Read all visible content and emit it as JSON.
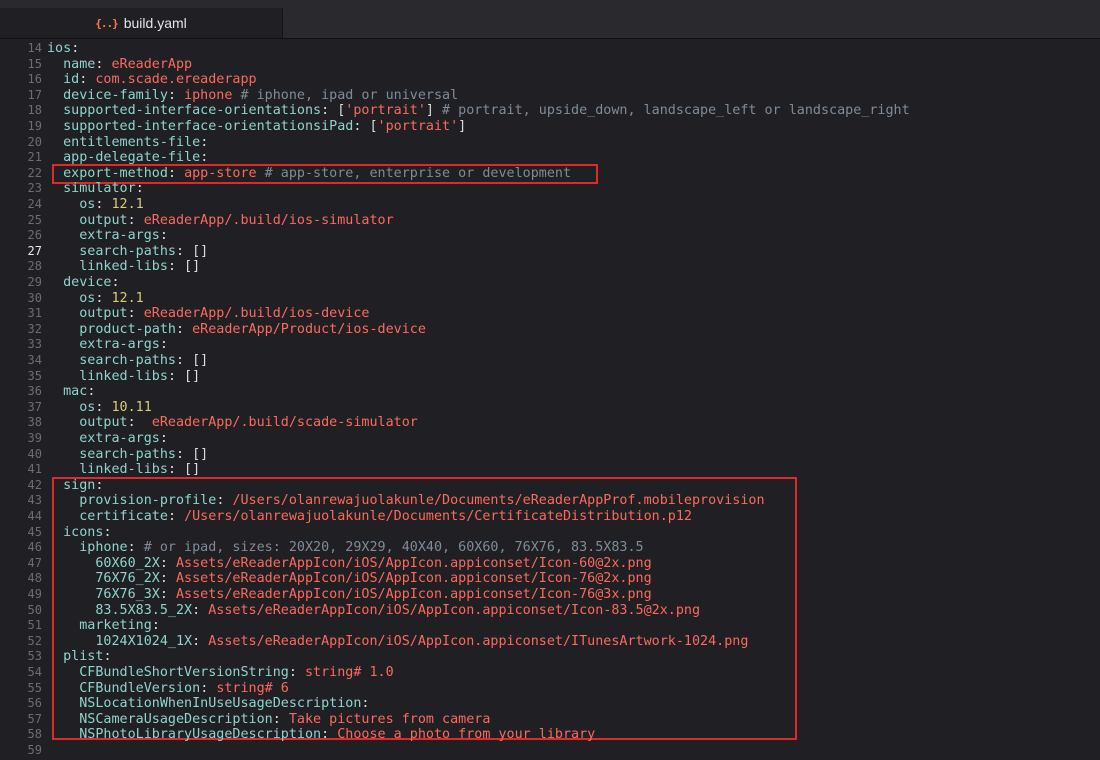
{
  "tab": {
    "icon_text": "{..}",
    "title": "build.yaml"
  },
  "lines": [
    {
      "no": "14",
      "parts": [
        {
          "t": "k",
          "v": "ios"
        },
        {
          "t": "p",
          "v": ":"
        }
      ]
    },
    {
      "no": "15",
      "parts": [
        {
          "t": "p",
          "v": "  "
        },
        {
          "t": "k",
          "v": "name"
        },
        {
          "t": "p",
          "v": ": "
        },
        {
          "t": "s",
          "v": "eReaderApp"
        }
      ]
    },
    {
      "no": "16",
      "parts": [
        {
          "t": "p",
          "v": "  "
        },
        {
          "t": "k",
          "v": "id"
        },
        {
          "t": "p",
          "v": ": "
        },
        {
          "t": "s",
          "v": "com.scade.ereaderapp"
        }
      ]
    },
    {
      "no": "17",
      "parts": [
        {
          "t": "p",
          "v": "  "
        },
        {
          "t": "k",
          "v": "device-family"
        },
        {
          "t": "p",
          "v": ": "
        },
        {
          "t": "s",
          "v": "iphone"
        },
        {
          "t": "c",
          "v": " # iphone, ipad or universal"
        }
      ]
    },
    {
      "no": "18",
      "parts": [
        {
          "t": "p",
          "v": "  "
        },
        {
          "t": "k",
          "v": "supported-interface-orientations"
        },
        {
          "t": "p",
          "v": ": ["
        },
        {
          "t": "s",
          "v": "'portrait'"
        },
        {
          "t": "p",
          "v": "]"
        },
        {
          "t": "c",
          "v": " # portrait, upside_down, landscape_left or landscape_right"
        }
      ]
    },
    {
      "no": "19",
      "parts": [
        {
          "t": "p",
          "v": "  "
        },
        {
          "t": "k",
          "v": "supported-interface-orientationsiPad"
        },
        {
          "t": "p",
          "v": ": ["
        },
        {
          "t": "s",
          "v": "'portrait'"
        },
        {
          "t": "p",
          "v": "]"
        }
      ]
    },
    {
      "no": "20",
      "parts": [
        {
          "t": "p",
          "v": "  "
        },
        {
          "t": "k",
          "v": "entitlements-file"
        },
        {
          "t": "p",
          "v": ":"
        }
      ]
    },
    {
      "no": "21",
      "parts": [
        {
          "t": "p",
          "v": "  "
        },
        {
          "t": "k",
          "v": "app-delegate-file"
        },
        {
          "t": "p",
          "v": ":"
        }
      ]
    },
    {
      "no": "22",
      "parts": [
        {
          "t": "p",
          "v": "  "
        },
        {
          "t": "k",
          "v": "export-method"
        },
        {
          "t": "p",
          "v": ": "
        },
        {
          "t": "s",
          "v": "app-store"
        },
        {
          "t": "c",
          "v": " # app-store, enterprise or development"
        }
      ]
    },
    {
      "no": "23",
      "parts": [
        {
          "t": "p",
          "v": "  "
        },
        {
          "t": "k",
          "v": "simulator"
        },
        {
          "t": "p",
          "v": ":"
        }
      ]
    },
    {
      "no": "24",
      "parts": [
        {
          "t": "p",
          "v": "    "
        },
        {
          "t": "k",
          "v": "os"
        },
        {
          "t": "p",
          "v": ": "
        },
        {
          "t": "n",
          "v": "12.1"
        }
      ]
    },
    {
      "no": "25",
      "parts": [
        {
          "t": "p",
          "v": "    "
        },
        {
          "t": "k",
          "v": "output"
        },
        {
          "t": "p",
          "v": ": "
        },
        {
          "t": "s",
          "v": "eReaderApp/.build/ios-simulator"
        }
      ]
    },
    {
      "no": "26",
      "parts": [
        {
          "t": "p",
          "v": "    "
        },
        {
          "t": "k",
          "v": "extra-args"
        },
        {
          "t": "p",
          "v": ":"
        }
      ]
    },
    {
      "no": "27",
      "current": true,
      "parts": [
        {
          "t": "p",
          "v": "    "
        },
        {
          "t": "k",
          "v": "search-paths"
        },
        {
          "t": "p",
          "v": ": []"
        }
      ]
    },
    {
      "no": "28",
      "parts": [
        {
          "t": "p",
          "v": "    "
        },
        {
          "t": "k",
          "v": "linked-libs"
        },
        {
          "t": "p",
          "v": ": []"
        }
      ]
    },
    {
      "no": "29",
      "parts": [
        {
          "t": "p",
          "v": "  "
        },
        {
          "t": "k",
          "v": "device"
        },
        {
          "t": "p",
          "v": ":"
        }
      ]
    },
    {
      "no": "30",
      "parts": [
        {
          "t": "p",
          "v": "    "
        },
        {
          "t": "k",
          "v": "os"
        },
        {
          "t": "p",
          "v": ": "
        },
        {
          "t": "n",
          "v": "12.1"
        }
      ]
    },
    {
      "no": "31",
      "parts": [
        {
          "t": "p",
          "v": "    "
        },
        {
          "t": "k",
          "v": "output"
        },
        {
          "t": "p",
          "v": ": "
        },
        {
          "t": "s",
          "v": "eReaderApp/.build/ios-device"
        }
      ]
    },
    {
      "no": "32",
      "parts": [
        {
          "t": "p",
          "v": "    "
        },
        {
          "t": "k",
          "v": "product-path"
        },
        {
          "t": "p",
          "v": ": "
        },
        {
          "t": "s",
          "v": "eReaderApp/Product/ios-device"
        }
      ]
    },
    {
      "no": "33",
      "parts": [
        {
          "t": "p",
          "v": "    "
        },
        {
          "t": "k",
          "v": "extra-args"
        },
        {
          "t": "p",
          "v": ":"
        }
      ]
    },
    {
      "no": "34",
      "parts": [
        {
          "t": "p",
          "v": "    "
        },
        {
          "t": "k",
          "v": "search-paths"
        },
        {
          "t": "p",
          "v": ": []"
        }
      ]
    },
    {
      "no": "35",
      "parts": [
        {
          "t": "p",
          "v": "    "
        },
        {
          "t": "k",
          "v": "linked-libs"
        },
        {
          "t": "p",
          "v": ": []"
        }
      ]
    },
    {
      "no": "36",
      "parts": [
        {
          "t": "p",
          "v": "  "
        },
        {
          "t": "k",
          "v": "mac"
        },
        {
          "t": "p",
          "v": ":"
        }
      ]
    },
    {
      "no": "37",
      "parts": [
        {
          "t": "p",
          "v": "    "
        },
        {
          "t": "k",
          "v": "os"
        },
        {
          "t": "p",
          "v": ": "
        },
        {
          "t": "n",
          "v": "10.11"
        }
      ]
    },
    {
      "no": "38",
      "parts": [
        {
          "t": "p",
          "v": "    "
        },
        {
          "t": "k",
          "v": "output"
        },
        {
          "t": "p",
          "v": ":  "
        },
        {
          "t": "s",
          "v": "eReaderApp/.build/scade-simulator"
        }
      ]
    },
    {
      "no": "39",
      "parts": [
        {
          "t": "p",
          "v": "    "
        },
        {
          "t": "k",
          "v": "extra-args"
        },
        {
          "t": "p",
          "v": ":"
        }
      ]
    },
    {
      "no": "40",
      "parts": [
        {
          "t": "p",
          "v": "    "
        },
        {
          "t": "k",
          "v": "search-paths"
        },
        {
          "t": "p",
          "v": ": []"
        }
      ]
    },
    {
      "no": "41",
      "parts": [
        {
          "t": "p",
          "v": "    "
        },
        {
          "t": "k",
          "v": "linked-libs"
        },
        {
          "t": "p",
          "v": ": []"
        }
      ]
    },
    {
      "no": "42",
      "parts": [
        {
          "t": "p",
          "v": "  "
        },
        {
          "t": "k",
          "v": "sign"
        },
        {
          "t": "p",
          "v": ":"
        }
      ]
    },
    {
      "no": "43",
      "parts": [
        {
          "t": "p",
          "v": "    "
        },
        {
          "t": "k",
          "v": "provision-profile"
        },
        {
          "t": "p",
          "v": ": "
        },
        {
          "t": "s",
          "v": "/Users/olanrewajuolakunle/Documents/eReaderAppProf.mobileprovision"
        }
      ]
    },
    {
      "no": "44",
      "parts": [
        {
          "t": "p",
          "v": "    "
        },
        {
          "t": "k",
          "v": "certificate"
        },
        {
          "t": "p",
          "v": ": "
        },
        {
          "t": "s",
          "v": "/Users/olanrewajuolakunle/Documents/CertificateDistribution.p12"
        }
      ]
    },
    {
      "no": "45",
      "parts": [
        {
          "t": "p",
          "v": "  "
        },
        {
          "t": "k",
          "v": "icons"
        },
        {
          "t": "p",
          "v": ":"
        }
      ]
    },
    {
      "no": "46",
      "parts": [
        {
          "t": "p",
          "v": "    "
        },
        {
          "t": "k",
          "v": "iphone"
        },
        {
          "t": "p",
          "v": ":"
        },
        {
          "t": "c",
          "v": " # or ipad, sizes: 20X20, 29X29, 40X40, 60X60, 76X76, 83.5X83.5"
        }
      ]
    },
    {
      "no": "47",
      "parts": [
        {
          "t": "p",
          "v": "      "
        },
        {
          "t": "k",
          "v": "60X60_2X"
        },
        {
          "t": "p",
          "v": ": "
        },
        {
          "t": "s",
          "v": "Assets/eReaderAppIcon/iOS/AppIcon.appiconset/Icon-60@2x.png"
        }
      ]
    },
    {
      "no": "48",
      "parts": [
        {
          "t": "p",
          "v": "      "
        },
        {
          "t": "k",
          "v": "76X76_2X"
        },
        {
          "t": "p",
          "v": ": "
        },
        {
          "t": "s",
          "v": "Assets/eReaderAppIcon/iOS/AppIcon.appiconset/Icon-76@2x.png"
        }
      ]
    },
    {
      "no": "49",
      "parts": [
        {
          "t": "p",
          "v": "      "
        },
        {
          "t": "k",
          "v": "76X76_3X"
        },
        {
          "t": "p",
          "v": ": "
        },
        {
          "t": "s",
          "v": "Assets/eReaderAppIcon/iOS/AppIcon.appiconset/Icon-76@3x.png"
        }
      ]
    },
    {
      "no": "50",
      "parts": [
        {
          "t": "p",
          "v": "      "
        },
        {
          "t": "k",
          "v": "83.5X83.5_2X"
        },
        {
          "t": "p",
          "v": ": "
        },
        {
          "t": "s",
          "v": "Assets/eReaderAppIcon/iOS/AppIcon.appiconset/Icon-83.5@2x.png"
        }
      ]
    },
    {
      "no": "51",
      "parts": [
        {
          "t": "p",
          "v": "    "
        },
        {
          "t": "k",
          "v": "marketing"
        },
        {
          "t": "p",
          "v": ":"
        }
      ]
    },
    {
      "no": "52",
      "parts": [
        {
          "t": "p",
          "v": "      "
        },
        {
          "t": "k",
          "v": "1024X1024_1X"
        },
        {
          "t": "p",
          "v": ": "
        },
        {
          "t": "s",
          "v": "Assets/eReaderAppIcon/iOS/AppIcon.appiconset/ITunesArtwork-1024.png"
        }
      ]
    },
    {
      "no": "53",
      "parts": [
        {
          "t": "p",
          "v": "  "
        },
        {
          "t": "k",
          "v": "plist"
        },
        {
          "t": "p",
          "v": ":"
        }
      ]
    },
    {
      "no": "54",
      "parts": [
        {
          "t": "p",
          "v": "    "
        },
        {
          "t": "k",
          "v": "CFBundleShortVersionString"
        },
        {
          "t": "p",
          "v": ": "
        },
        {
          "t": "s",
          "v": "string# 1.0"
        }
      ]
    },
    {
      "no": "55",
      "parts": [
        {
          "t": "p",
          "v": "    "
        },
        {
          "t": "k",
          "v": "CFBundleVersion"
        },
        {
          "t": "p",
          "v": ": "
        },
        {
          "t": "s",
          "v": "string# 6"
        }
      ]
    },
    {
      "no": "56",
      "parts": [
        {
          "t": "p",
          "v": "    "
        },
        {
          "t": "k",
          "v": "NSLocationWhenInUseUsageDescription"
        },
        {
          "t": "p",
          "v": ":"
        }
      ]
    },
    {
      "no": "57",
      "parts": [
        {
          "t": "p",
          "v": "    "
        },
        {
          "t": "k",
          "v": "NSCameraUsageDescription"
        },
        {
          "t": "p",
          "v": ": "
        },
        {
          "t": "s",
          "v": "Take pictures from camera"
        }
      ]
    },
    {
      "no": "58",
      "parts": [
        {
          "t": "p",
          "v": "    "
        },
        {
          "t": "k",
          "v": "NSPhotoLibraryUsageDescription"
        },
        {
          "t": "p",
          "v": ": "
        },
        {
          "t": "s",
          "v": "Choose a photo from your library"
        }
      ]
    },
    {
      "no": "59",
      "parts": []
    }
  ],
  "colors": {
    "key": "#8fd4cc",
    "string": "#fc6a5d",
    "number": "#d9c97c",
    "comment": "#7f8c98",
    "highlight_box": "#e02a2a"
  }
}
